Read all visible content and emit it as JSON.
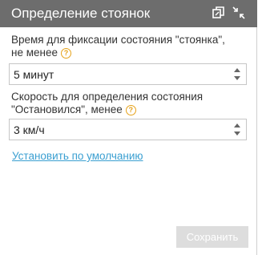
{
  "panel": {
    "title": "Определение стоянок"
  },
  "icons": {
    "copy": "copy-icon",
    "shrink": "shrink-icon",
    "help": "question-circle-icon"
  },
  "parking_time": {
    "label_line1": "Время для фиксации состояния \"стоянка\",",
    "label_line2": "не менее",
    "value": "5 минут"
  },
  "stop_speed": {
    "label_line1": "Скорость для определения состояния",
    "label_line2": "\"Остановился\", менее",
    "value": "3 км/ч"
  },
  "reset_link": "Установить по умолчанию",
  "save_label": "Сохранить",
  "colors": {
    "header": "#6d6d6d",
    "link": "#3a9fd1",
    "help": "#e6a21a",
    "button_disabled": "#dddddd"
  }
}
